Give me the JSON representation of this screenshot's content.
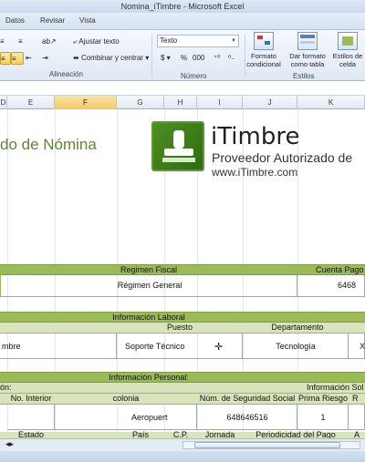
{
  "window": {
    "title": "Nomina_iTimbre - Microsoft Excel"
  },
  "ribbon": {
    "tabs": [
      "Datos",
      "Revisar",
      "Vista"
    ],
    "alineacion": {
      "wrap_label": "Ajustar texto",
      "merge_label": "Combinar y centrar",
      "group_label": "Alineación"
    },
    "numero": {
      "format_value": "Texto",
      "currency": "$",
      "percent": "%",
      "thousands": "000",
      "group_label": "Número"
    },
    "estilos": {
      "conditional": "Formato condicional",
      "as_table": "Dar formato como tabla",
      "cell_styles": "Estilos de celda",
      "group_label": "Estilos"
    }
  },
  "columns": [
    "D",
    "E",
    "F",
    "G",
    "H",
    "I",
    "J",
    "K"
  ],
  "selected_column": "F",
  "sheet": {
    "doc_title": "do de Nómina",
    "brand": {
      "name": "iTimbre",
      "tagline": "Proveedor Autorizado de",
      "url": "www.iTimbre.com"
    },
    "fiscal": {
      "header": "Regimen Fiscal",
      "value": "Régimen General",
      "cuenta_header": "Cuenta Pago",
      "cuenta_value": "6468"
    },
    "laboral": {
      "header": "Información Laboral",
      "puesto_header": "Puesto",
      "depto_header": "Departamento",
      "left_value": "mbre",
      "puesto_value": "Soporte Técnico",
      "depto_value": "Tecnología",
      "right_value": "X"
    },
    "personal": {
      "header": "Información Personal:",
      "left_header": "ón:",
      "right_header": "Información Sol",
      "cols": [
        "No. Interior",
        "colonia",
        "Núm. de Seguridad Social",
        "Prima Riesgo",
        "R"
      ],
      "values": [
        "",
        "Aeropuert",
        "648646516",
        "1",
        ""
      ],
      "next_row": [
        "Estado",
        "País",
        "C.P.",
        "Jornada",
        "Periodicidad del Pago",
        "A"
      ]
    }
  }
}
